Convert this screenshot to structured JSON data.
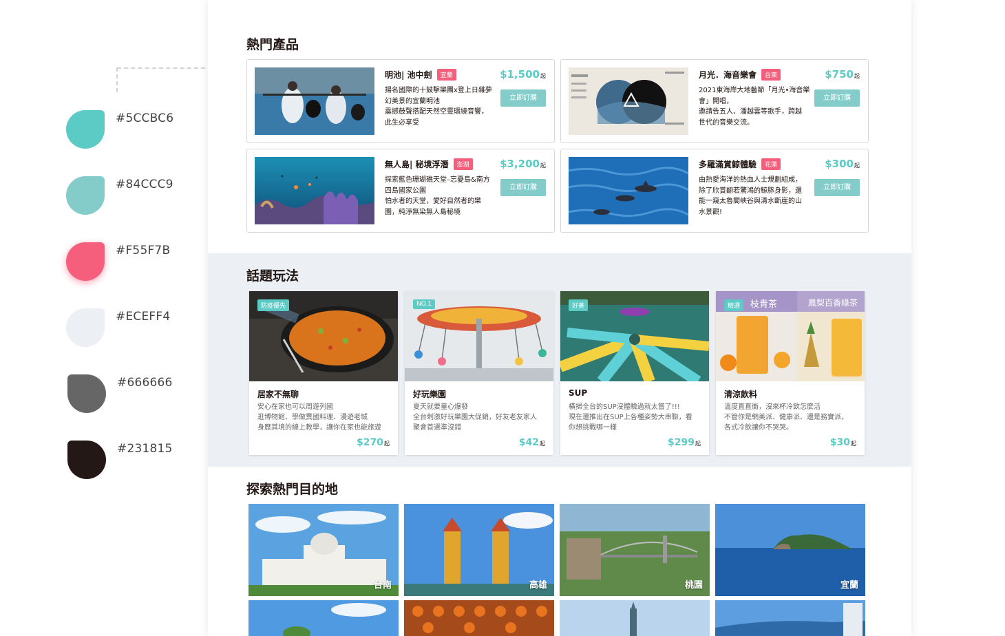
{
  "palette": [
    {
      "hex": "#5CCBC6",
      "label": "#5CCBC6"
    },
    {
      "hex": "#84CCC9",
      "label": "#84CCC9"
    },
    {
      "hex": "#F55F7B",
      "label": "#F55F7B"
    },
    {
      "hex": "#ECEFF4",
      "label": "#ECEFF4"
    },
    {
      "hex": "#666666",
      "label": "#666666"
    },
    {
      "hex": "#231815",
      "label": "#231815"
    }
  ],
  "hot_products": {
    "title": "熱門產品",
    "items": [
      {
        "name": "明池| 池中劍",
        "tag": "宜蘭",
        "price": "$1,500",
        "price_suffix": "起",
        "button": "立即訂購",
        "desc_lines": [
          "揚名國際的十鼓擊樂團x登上日雜夢",
          "幻美景的宜蘭明池",
          "震撼鼓聲搭配天然空靈環繞音響，",
          "此生必享受"
        ],
        "icon": "drummers-lake-photo"
      },
      {
        "name": "月光．海音樂會",
        "tag": "台東",
        "price": "$750",
        "price_suffix": "起",
        "button": "立即訂購",
        "desc_lines": [
          "2021東海岸大地藝節「月光•海音樂",
          "會」開唱，",
          "邀請告五人、潘越雲等歌手，跨越",
          "世代的音樂交流。"
        ],
        "icon": "concert-poster"
      },
      {
        "name": "無人島| 秘境浮潛",
        "tag": "澎湖",
        "price": "$3,200",
        "price_suffix": "起",
        "button": "立即訂購",
        "desc_lines": [
          "探索藍色珊瑚礁天堂–忘憂島&南方",
          "四島國家公園",
          "怕水者的天堂，愛好自然者的樂",
          "園，純淨無染無人島秘境"
        ],
        "icon": "coral-reef-photo"
      },
      {
        "name": "多羅滿賞鯨體驗",
        "tag": "花蓮",
        "price": "$300",
        "price_suffix": "起",
        "button": "立即訂購",
        "desc_lines": [
          "由熱愛海洋的熱血人士規劃組成，",
          "除了欣賞翻若驚鴻的鯨豚身影，還",
          "能一窺太魯閣峽谷與清水斷崖的山",
          "水景觀!"
        ],
        "icon": "dolphins-photo"
      }
    ]
  },
  "topics": {
    "title": "話題玩法",
    "items": [
      {
        "tag": "防疫優先",
        "title": "居家不無聊",
        "desc_lines": [
          "安心在家也可以周遊列國",
          "逛博物館、學做異國料理、漫遊老城",
          "身歷其境的線上教學，讓你在家也能旅遊"
        ],
        "price": "$270",
        "price_suffix": "起",
        "icon": "paella-photo"
      },
      {
        "tag": "NO.1",
        "title": "好玩樂園",
        "desc_lines": [
          "夏天就要童心爆發",
          "全台刺激好玩樂園大促銷，好友老友家人",
          "聚會首選準沒錯"
        ],
        "price": "$42",
        "price_suffix": "起",
        "icon": "swing-ride-photo"
      },
      {
        "tag": "好美",
        "title": "SUP",
        "desc_lines": [
          "橫掃全台的SUP沒體驗過就太嘗了!!!",
          "現在還推出在SUP上各種姿勢大串聯，看",
          "你想挑戰哪一樣"
        ],
        "price": "$299",
        "price_suffix": "起",
        "icon": "sup-yoga-photo"
      },
      {
        "tag": "精選",
        "title": "清涼飲料",
        "desc_lines": [
          "溫度直直衝，沒來杯冷飲怎麼活",
          "不管你是網美派、健康派、還是務實派，",
          "各式冷飲讓你不哭哭。"
        ],
        "price": "$30",
        "price_suffix": "起",
        "icon": "drinks-photo",
        "img_text_left": "枝青茶",
        "img_text_right": "鳳梨百香綠茶"
      }
    ]
  },
  "destinations": {
    "title": "探索熱門目的地",
    "items": [
      {
        "label": "台南",
        "icon": "museum-photo"
      },
      {
        "label": "高雄",
        "icon": "pagoda-photo"
      },
      {
        "label": "桃園",
        "icon": "bridge-photo"
      },
      {
        "label": "宜蘭",
        "icon": "island-photo"
      },
      {
        "label": "",
        "icon": "tree-photo"
      },
      {
        "label": "",
        "icon": "persimmon-photo"
      },
      {
        "label": "",
        "icon": "taipei101-photo"
      },
      {
        "label": "",
        "icon": "building-photo"
      }
    ]
  }
}
